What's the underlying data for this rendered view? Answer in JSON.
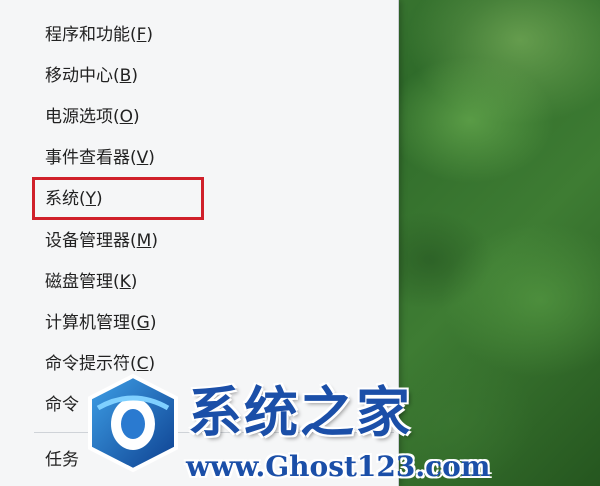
{
  "menu": {
    "items": [
      {
        "label": "程序和功能",
        "key": "F"
      },
      {
        "label": "移动中心",
        "key": "B"
      },
      {
        "label": "电源选项",
        "key": "O"
      },
      {
        "label": "事件查看器",
        "key": "V"
      },
      {
        "label": "系统",
        "key": "Y"
      },
      {
        "label": "设备管理器",
        "key": "M"
      },
      {
        "label": "磁盘管理",
        "key": "K"
      },
      {
        "label": "计算机管理",
        "key": "G"
      },
      {
        "label": "命令提示符",
        "key": "C"
      },
      {
        "label": "命令",
        "key": ""
      },
      {
        "label": "任务",
        "key": ""
      }
    ],
    "highlighted_item": "系统"
  },
  "watermark": {
    "title": "系统之家",
    "url": "www.Ghost123.com"
  },
  "colors": {
    "highlight_border": "#d0202a",
    "watermark_blue": "#1b4fa8",
    "menu_background": "#f5f6f7"
  }
}
